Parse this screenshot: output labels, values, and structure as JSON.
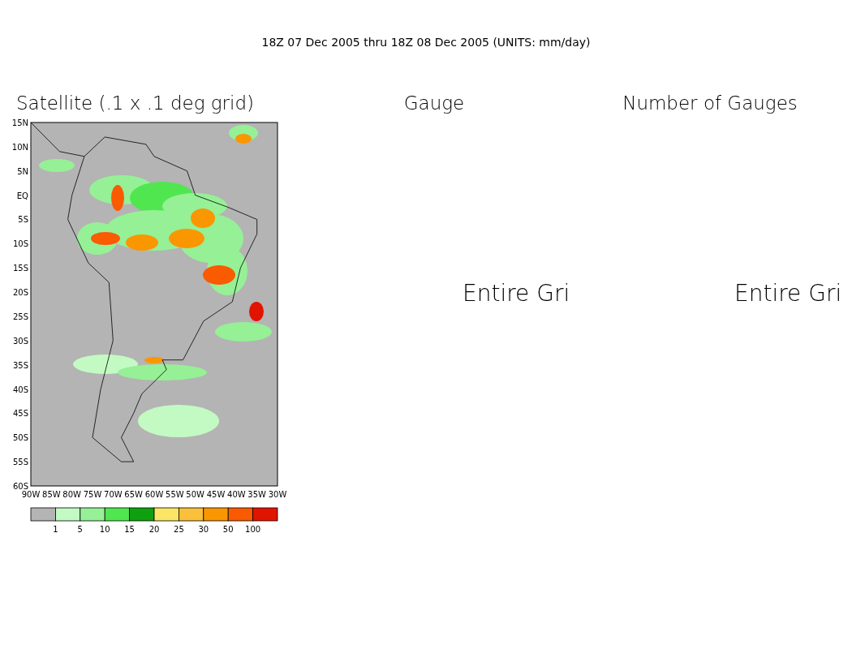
{
  "title": "18Z 07 Dec 2005 thru 18Z 08 Dec 2005 (UNITS: mm/day)",
  "panels": [
    {
      "kind": "map",
      "title": "Satellite (.1 x .1 deg grid)",
      "lat_labels": [
        "15N",
        "10N",
        "5N",
        "EQ",
        "5S",
        "10S",
        "15S",
        "20S",
        "25S",
        "30S",
        "35S",
        "40S",
        "45S",
        "50S",
        "55S",
        "60S"
      ],
      "lon_labels": [
        "90W",
        "85W",
        "80W",
        "75W",
        "70W",
        "65W",
        "60W",
        "55W",
        "50W",
        "45W",
        "40W",
        "35W",
        "30W"
      ]
    },
    {
      "kind": "empty",
      "title": "Gauge",
      "message": "Entire Gri"
    },
    {
      "kind": "empty",
      "title": "Number of Gauges",
      "message": "Entire Gri"
    }
  ],
  "colorbar": {
    "bins": [
      {
        "color": "#b4b4b4"
      },
      {
        "color": "#c3fac3"
      },
      {
        "color": "#96f096"
      },
      {
        "color": "#50e650"
      },
      {
        "color": "#0fa00f"
      },
      {
        "color": "#fae664"
      },
      {
        "color": "#fac03c"
      },
      {
        "color": "#fa9600"
      },
      {
        "color": "#fa5a00"
      },
      {
        "color": "#e11400"
      }
    ],
    "labels": [
      "1",
      "5",
      "10",
      "15",
      "20",
      "25",
      "30",
      "50",
      "100"
    ]
  }
}
